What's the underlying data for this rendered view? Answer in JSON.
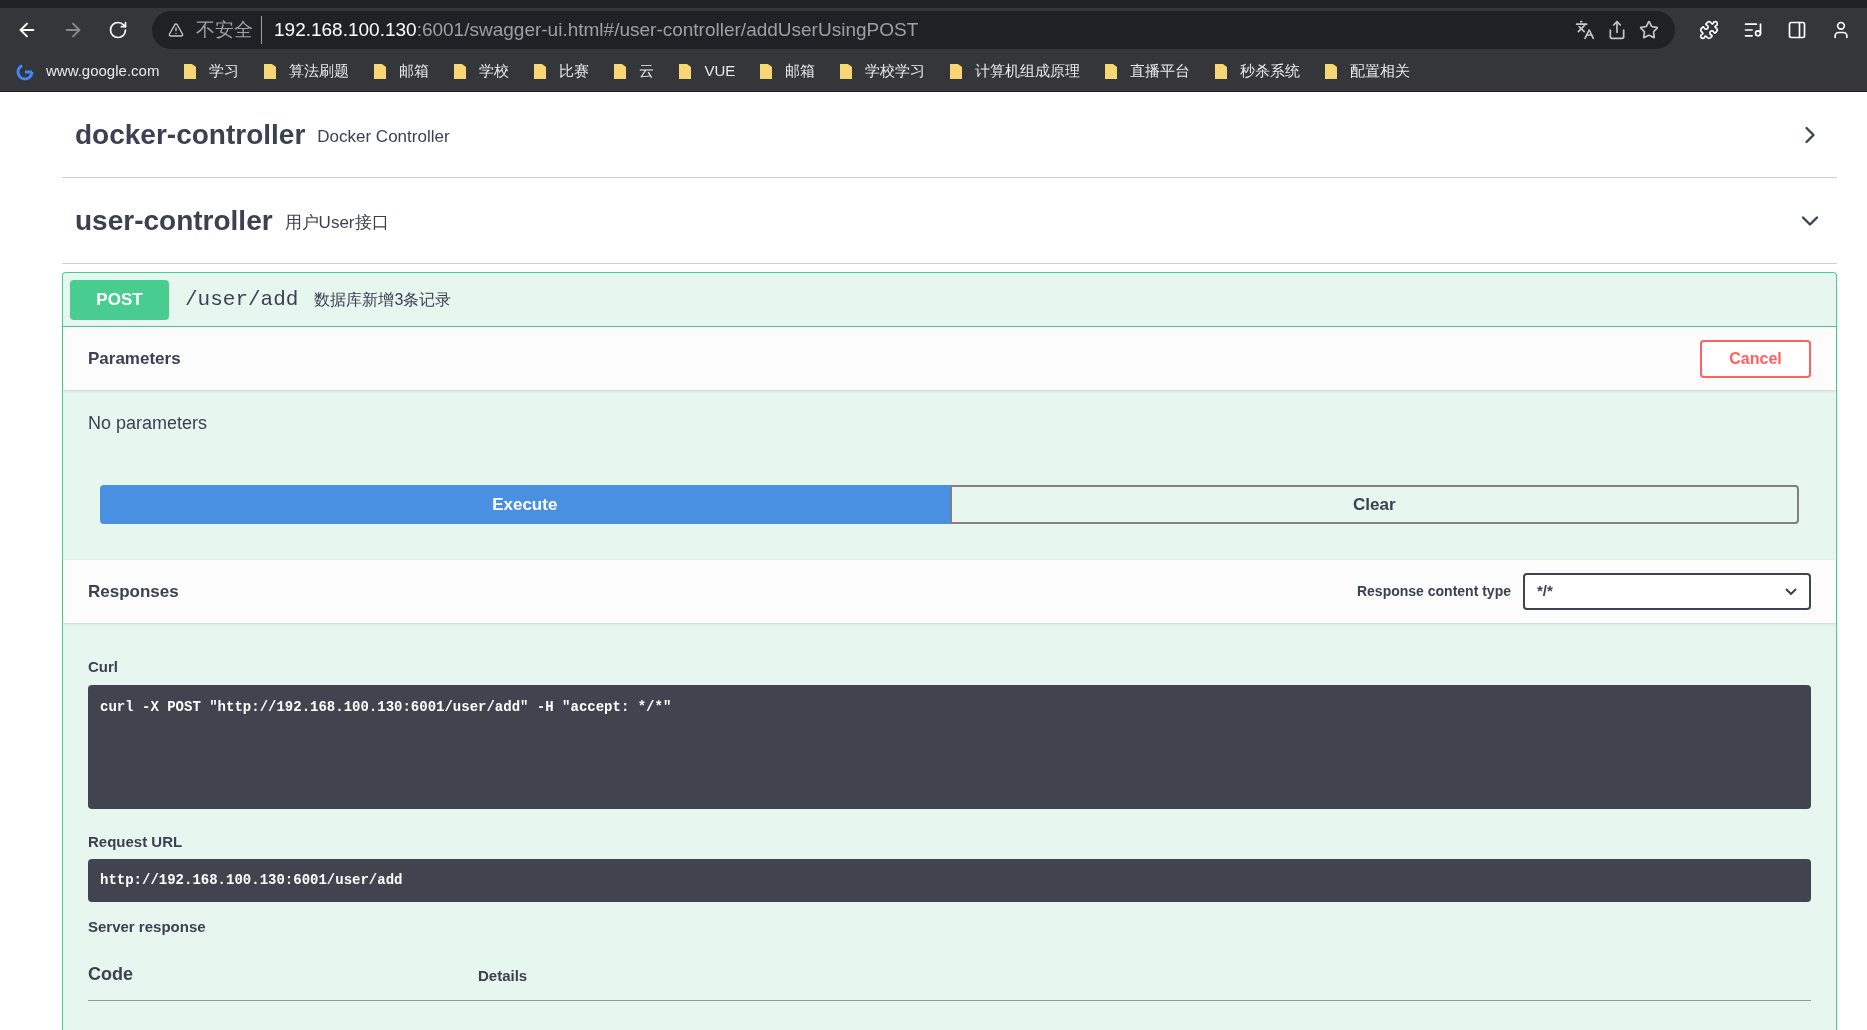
{
  "browser": {
    "security_label": "不安全",
    "url_host": "192.168.100.130",
    "url_rest": ":6001/swagger-ui.html#/user-controller/addUserUsingPOST"
  },
  "bookmarks": [
    {
      "kind": "site",
      "label": "www.google.com"
    },
    {
      "kind": "folder",
      "label": "学习"
    },
    {
      "kind": "folder",
      "label": "算法刷题"
    },
    {
      "kind": "folder",
      "label": "邮箱"
    },
    {
      "kind": "folder",
      "label": "学校"
    },
    {
      "kind": "folder",
      "label": "比赛"
    },
    {
      "kind": "folder",
      "label": "云"
    },
    {
      "kind": "folder",
      "label": "VUE"
    },
    {
      "kind": "folder",
      "label": "邮箱"
    },
    {
      "kind": "folder",
      "label": "学校学习"
    },
    {
      "kind": "folder",
      "label": "计算机组成原理"
    },
    {
      "kind": "folder",
      "label": "直播平台"
    },
    {
      "kind": "folder",
      "label": "秒杀系统"
    },
    {
      "kind": "folder",
      "label": "配置相关"
    }
  ],
  "sections": [
    {
      "name": "docker-controller",
      "description": "Docker Controller",
      "expanded": false
    },
    {
      "name": "user-controller",
      "description": "用户User接口",
      "expanded": true
    }
  ],
  "operation": {
    "method": "POST",
    "path": "/user/add",
    "summary": "数据库新增3条记录",
    "parameters_title": "Parameters",
    "cancel_label": "Cancel",
    "no_parameters": "No parameters",
    "execute_label": "Execute",
    "clear_label": "Clear",
    "responses_title": "Responses",
    "content_type_label": "Response content type",
    "content_type_value": "*/*",
    "curl_label": "Curl",
    "curl": "curl -X POST \"http://192.168.100.130:6001/user/add\" -H \"accept: */*\"",
    "request_url_label": "Request URL",
    "request_url": "http://192.168.100.130:6001/user/add",
    "server_response_label": "Server response",
    "columns": [
      "Code",
      "Details"
    ]
  }
}
